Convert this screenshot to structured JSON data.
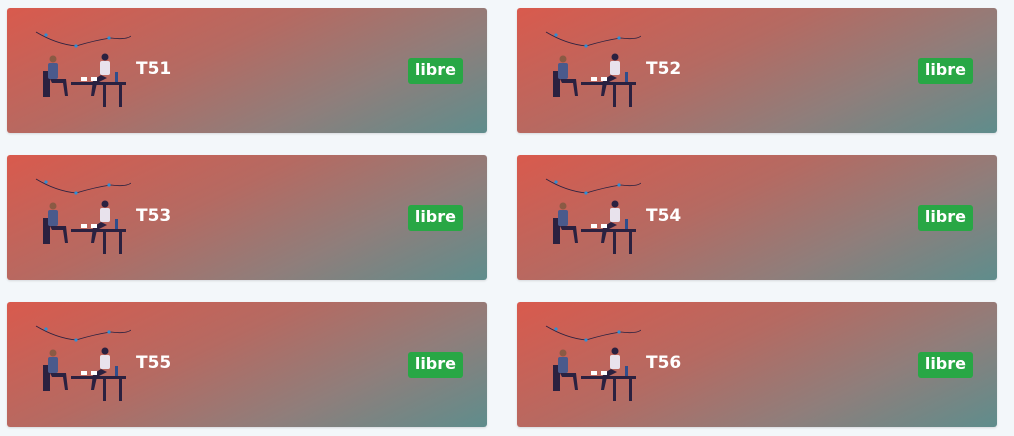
{
  "tables": [
    {
      "label": "T51",
      "status": "libre"
    },
    {
      "label": "T52",
      "status": "libre"
    },
    {
      "label": "T53",
      "status": "libre"
    },
    {
      "label": "T54",
      "status": "libre"
    },
    {
      "label": "T55",
      "status": "libre"
    },
    {
      "label": "T56",
      "status": "libre"
    }
  ],
  "colors": {
    "background": "#f3f7fa",
    "card_gradient_start": "#d95a4d",
    "card_gradient_end": "#5f8d8c",
    "status_free": "#28a745",
    "text": "#ffffff"
  },
  "icons": {
    "illustration": "dinner-couple-illustration"
  }
}
